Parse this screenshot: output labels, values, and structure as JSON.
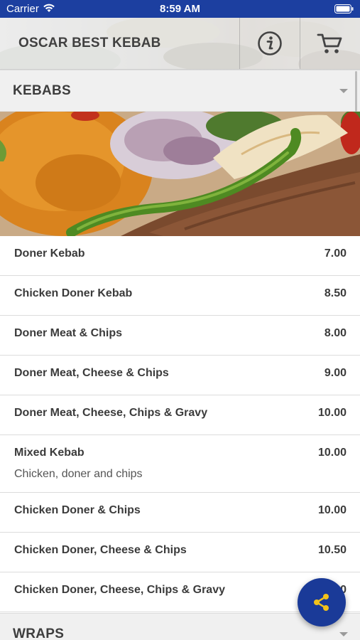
{
  "status_bar": {
    "carrier": "Carrier",
    "time": "8:59 AM",
    "wifi_icon": "wifi-icon",
    "battery_icon": "battery-icon"
  },
  "header": {
    "title": "OSCAR BEST KEBAB",
    "info_icon": "info-icon",
    "cart_icon": "cart-icon"
  },
  "sections": [
    {
      "title": "KEBABS",
      "items": [
        {
          "name": "Doner Kebab",
          "price": "7.00"
        },
        {
          "name": "Chicken Doner Kebab",
          "price": "8.50"
        },
        {
          "name": "Doner Meat & Chips",
          "price": "8.00"
        },
        {
          "name": "Doner Meat, Cheese & Chips",
          "price": "9.00"
        },
        {
          "name": "Doner Meat, Cheese, Chips & Gravy",
          "price": "10.00"
        },
        {
          "name": "Mixed Kebab",
          "price": "10.00",
          "description": "Chicken, doner and chips"
        },
        {
          "name": "Chicken Doner & Chips",
          "price": "10.00"
        },
        {
          "name": "Chicken Doner, Cheese & Chips",
          "price": "10.50"
        },
        {
          "name": "Chicken Doner, Cheese, Chips & Gravy",
          "price": "11.00"
        }
      ]
    },
    {
      "title": "WRAPS",
      "items": []
    }
  ],
  "fab": {
    "icon": "share-icon"
  },
  "colors": {
    "brand_blue": "#1c3fa0",
    "fab_blue": "#1a3a98",
    "section_bg": "#f0f0f0"
  }
}
